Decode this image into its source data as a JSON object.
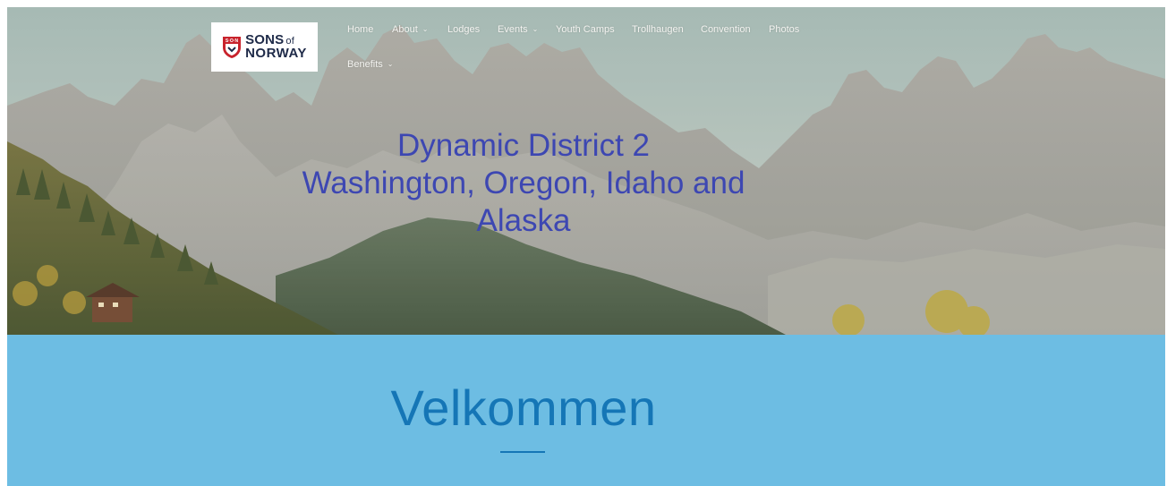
{
  "logo": {
    "line1": "SONS",
    "line1_suffix": "of",
    "line2": "NORWAY",
    "emblem_text": "S·O·N"
  },
  "nav": {
    "items": [
      {
        "label": "Home",
        "has_dropdown": false
      },
      {
        "label": "About",
        "has_dropdown": true
      },
      {
        "label": "Lodges",
        "has_dropdown": false
      },
      {
        "label": "Events",
        "has_dropdown": true
      },
      {
        "label": "Youth Camps",
        "has_dropdown": false
      },
      {
        "label": "Trollhaugen",
        "has_dropdown": false
      },
      {
        "label": "Convention",
        "has_dropdown": false
      },
      {
        "label": "Photos",
        "has_dropdown": false
      },
      {
        "label": "Benefits",
        "has_dropdown": true
      }
    ],
    "chevron_icon": "chevron-down-icon"
  },
  "hero": {
    "title_lines": [
      "Dynamic District 2",
      "Washington, Oregon, Idaho and",
      "Alaska"
    ]
  },
  "welcome": {
    "title": "Velkommen"
  },
  "colors": {
    "hero_title": "#3d47b2",
    "welcome_bg": "#6dbde3",
    "welcome_title": "#1576b6",
    "logo_red": "#c8232c",
    "logo_navy": "#1e2a48"
  }
}
